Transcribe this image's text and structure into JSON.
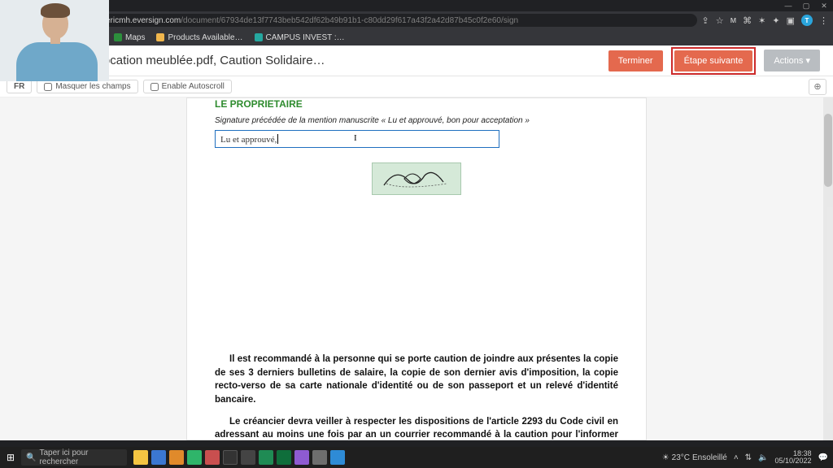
{
  "browser": {
    "url_host": "ericmh.eversign.com",
    "url_path": "/document/67934de13f7743beb542df62b49b91b1-c80dd29f617a43f2a42d87b45c0f2e60/sign",
    "bookmarks": {
      "maps": "Maps",
      "products": "Products Available…",
      "campus": "CAMPUS INVEST :…"
    },
    "window_controls": {
      "min": "—",
      "max": "▢",
      "close": "✕"
    }
  },
  "app": {
    "doc_title": "ument : Contrat location meublée.pdf, Caution Solidaire…",
    "terminer": "Terminer",
    "etape": "Étape suivante",
    "actions": "Actions ▾",
    "toolbar": {
      "lang": "FR",
      "mask": "Masquer les champs",
      "autoscroll": "Enable Autoscroll",
      "zoom_icon": "⊕"
    }
  },
  "document": {
    "section_title": "LE PROPRIETAIRE",
    "mention": "Signature précédée de la mention manuscrite « Lu et approuvé, bon pour acceptation »",
    "input_value": "Lu et approuvé,",
    "para1": "Il est recommandé à la personne qui se porte caution de joindre aux présentes la copie de ses 3 derniers bulletins de salaire, la copie de son dernier avis d'imposition, la copie recto-verso de sa carte nationale d'identité ou de son passeport et un relevé d'identité bancaire.",
    "para2": "Le créancier devra veiller à respecter les dispositions de l'article 2293 du Code civil en adressant au moins une fois par an un courrier recommandé à la caution pour l'informer de l'évolution du montant de la créance garantie sous peine de déchéance des accessoires, frais et pénalités."
  },
  "taskbar": {
    "search_placeholder": "Taper ici pour rechercher",
    "weather_temp": "23°C",
    "weather_label": "Ensoleillé",
    "time": "18:38",
    "date": "05/10/2022"
  }
}
